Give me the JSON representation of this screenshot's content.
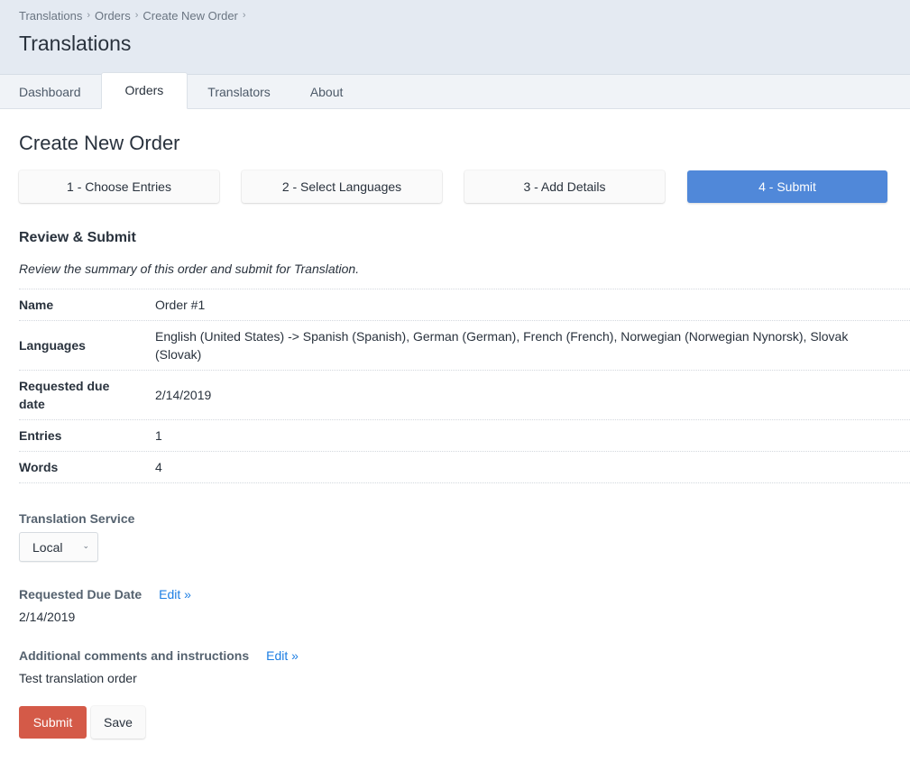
{
  "breadcrumb": [
    "Translations",
    "Orders",
    "Create New Order"
  ],
  "breadcrumb_separator": "›",
  "header": {
    "title": "Translations"
  },
  "tabs": [
    {
      "label": "Dashboard",
      "active": false
    },
    {
      "label": "Orders",
      "active": true
    },
    {
      "label": "Translators",
      "active": false
    },
    {
      "label": "About",
      "active": false
    }
  ],
  "page_title": "Create New Order",
  "steps": [
    {
      "label": "1 - Choose Entries",
      "active": false
    },
    {
      "label": "2 - Select Languages",
      "active": false
    },
    {
      "label": "3 - Add Details",
      "active": false
    },
    {
      "label": "4 - Submit",
      "active": true
    }
  ],
  "review": {
    "title": "Review & Submit",
    "intro": "Review the summary of this order and submit for Translation.",
    "rows": [
      {
        "key": "Name",
        "value": "Order #1"
      },
      {
        "key": "Languages",
        "value": "English (United States) -> Spanish (Spanish), German (German), French (French), Norwegian (Norwegian Nynorsk), Slovak (Slovak)"
      },
      {
        "key": "Requested due date",
        "value": "2/14/2019"
      },
      {
        "key": "Entries",
        "value": "1"
      },
      {
        "key": "Words",
        "value": "4"
      }
    ]
  },
  "translation_service": {
    "label": "Translation Service",
    "selected": "Local",
    "chevron_icon": "⌄"
  },
  "due_date": {
    "label": "Requested Due Date",
    "edit_label": "Edit »",
    "value": "2/14/2019"
  },
  "comments": {
    "label": "Additional comments and instructions",
    "edit_label": "Edit »",
    "value": "Test translation order"
  },
  "actions": {
    "submit_label": "Submit",
    "save_label": "Save"
  },
  "colors": {
    "active_step": "#5088d9",
    "submit_button": "#d45a48",
    "link": "#1c7ee3",
    "header_bg": "#e4eaf2"
  }
}
